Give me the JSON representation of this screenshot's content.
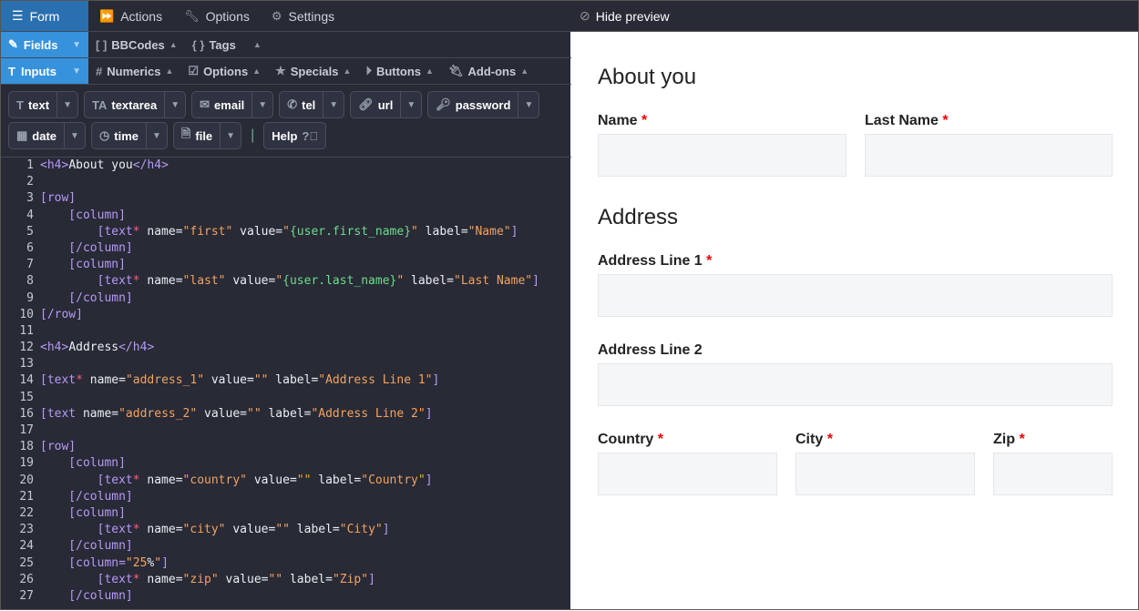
{
  "nav": {
    "tabs": [
      {
        "label": "Form",
        "icon": "list-icon"
      },
      {
        "label": "Actions",
        "icon": "fast-forward-icon"
      },
      {
        "label": "Options",
        "icon": "wrench-icon"
      },
      {
        "label": "Settings",
        "icon": "gear-icon"
      }
    ],
    "preview_toggle": "Hide preview"
  },
  "sections": {
    "fields": "Fields",
    "inputs": "Inputs"
  },
  "fields_row": [
    {
      "label": "BBCodes",
      "icon": "brackets-icon"
    },
    {
      "label": "Tags",
      "icon": "braces-icon"
    }
  ],
  "inputs_row": [
    {
      "label": "Numerics",
      "icon": "hash-icon"
    },
    {
      "label": "Options",
      "icon": "checkbox-icon"
    },
    {
      "label": "Specials",
      "icon": "star-icon"
    },
    {
      "label": "Buttons",
      "icon": "play-circle-icon"
    },
    {
      "label": "Add-ons",
      "icon": "plug-icon"
    }
  ],
  "toolbar": {
    "row1": [
      "text",
      "textarea",
      "email",
      "tel",
      "url",
      "password"
    ],
    "row2": [
      "date",
      "time",
      "file"
    ],
    "help": "Help"
  },
  "code": [
    [
      [
        "t",
        "<h4>"
      ],
      [
        "w",
        "About you"
      ],
      [
        "t",
        "</h4>"
      ]
    ],
    [],
    [
      [
        "t",
        "[row]"
      ]
    ],
    [
      [
        "t",
        "    [column]"
      ]
    ],
    [
      [
        "t",
        "        [text"
      ],
      [
        "s",
        "*"
      ],
      [
        "w",
        " name="
      ],
      [
        "o",
        "\"first\""
      ],
      [
        "w",
        " value="
      ],
      [
        "o",
        "\""
      ],
      [
        "g",
        "{user.first_name}"
      ],
      [
        "o",
        "\""
      ],
      [
        "w",
        " label="
      ],
      [
        "o",
        "\"Name\""
      ],
      [
        "t",
        "]"
      ]
    ],
    [
      [
        "t",
        "    [/column]"
      ]
    ],
    [
      [
        "t",
        "    [column]"
      ]
    ],
    [
      [
        "t",
        "        [text"
      ],
      [
        "s",
        "*"
      ],
      [
        "w",
        " name="
      ],
      [
        "o",
        "\"last\""
      ],
      [
        "w",
        " value="
      ],
      [
        "o",
        "\""
      ],
      [
        "g",
        "{user.last_name}"
      ],
      [
        "o",
        "\""
      ],
      [
        "w",
        " label="
      ],
      [
        "o",
        "\"Last Name\""
      ],
      [
        "t",
        "]"
      ]
    ],
    [
      [
        "t",
        "    [/column]"
      ]
    ],
    [
      [
        "t",
        "[/row]"
      ]
    ],
    [],
    [
      [
        "t",
        "<h4>"
      ],
      [
        "w",
        "Address"
      ],
      [
        "t",
        "</h4>"
      ]
    ],
    [],
    [
      [
        "t",
        "[text"
      ],
      [
        "s",
        "*"
      ],
      [
        "w",
        " name="
      ],
      [
        "o",
        "\"address_1\""
      ],
      [
        "w",
        " value="
      ],
      [
        "o",
        "\"\""
      ],
      [
        "w",
        " label="
      ],
      [
        "o",
        "\"Address Line 1\""
      ],
      [
        "t",
        "]"
      ]
    ],
    [],
    [
      [
        "t",
        "[text"
      ],
      [
        "w",
        " name="
      ],
      [
        "o",
        "\"address_2\""
      ],
      [
        "w",
        " value="
      ],
      [
        "o",
        "\"\""
      ],
      [
        "w",
        " label="
      ],
      [
        "o",
        "\"Address Line 2\""
      ],
      [
        "t",
        "]"
      ]
    ],
    [],
    [
      [
        "t",
        "[row]"
      ]
    ],
    [
      [
        "t",
        "    [column]"
      ]
    ],
    [
      [
        "t",
        "        [text"
      ],
      [
        "s",
        "*"
      ],
      [
        "w",
        " name="
      ],
      [
        "o",
        "\"country\""
      ],
      [
        "w",
        " value="
      ],
      [
        "o",
        "\"\""
      ],
      [
        "w",
        " label="
      ],
      [
        "o",
        "\"Country\""
      ],
      [
        "t",
        "]"
      ]
    ],
    [
      [
        "t",
        "    [/column]"
      ]
    ],
    [
      [
        "t",
        "    [column]"
      ]
    ],
    [
      [
        "t",
        "        [text"
      ],
      [
        "s",
        "*"
      ],
      [
        "w",
        " name="
      ],
      [
        "o",
        "\"city\""
      ],
      [
        "w",
        " value="
      ],
      [
        "o",
        "\"\""
      ],
      [
        "w",
        " label="
      ],
      [
        "o",
        "\"City\""
      ],
      [
        "t",
        "]"
      ]
    ],
    [
      [
        "t",
        "    [/column]"
      ]
    ],
    [
      [
        "t",
        "    [column="
      ],
      [
        "o",
        "\"25"
      ],
      [
        "w",
        "%"
      ],
      [
        "o",
        "\""
      ],
      [
        "t",
        "]"
      ]
    ],
    [
      [
        "t",
        "        [text"
      ],
      [
        "s",
        "*"
      ],
      [
        "w",
        " name="
      ],
      [
        "o",
        "\"zip\""
      ],
      [
        "w",
        " value="
      ],
      [
        "o",
        "\"\""
      ],
      [
        "w",
        " label="
      ],
      [
        "o",
        "\"Zip\""
      ],
      [
        "t",
        "]"
      ]
    ],
    [
      [
        "t",
        "    [/column]"
      ]
    ]
  ],
  "preview": {
    "h_about": "About you",
    "name": "Name",
    "last_name": "Last Name",
    "h_address": "Address",
    "addr1": "Address Line 1",
    "addr2": "Address Line 2",
    "country": "Country",
    "city": "City",
    "zip": "Zip",
    "required_mark": "*"
  }
}
